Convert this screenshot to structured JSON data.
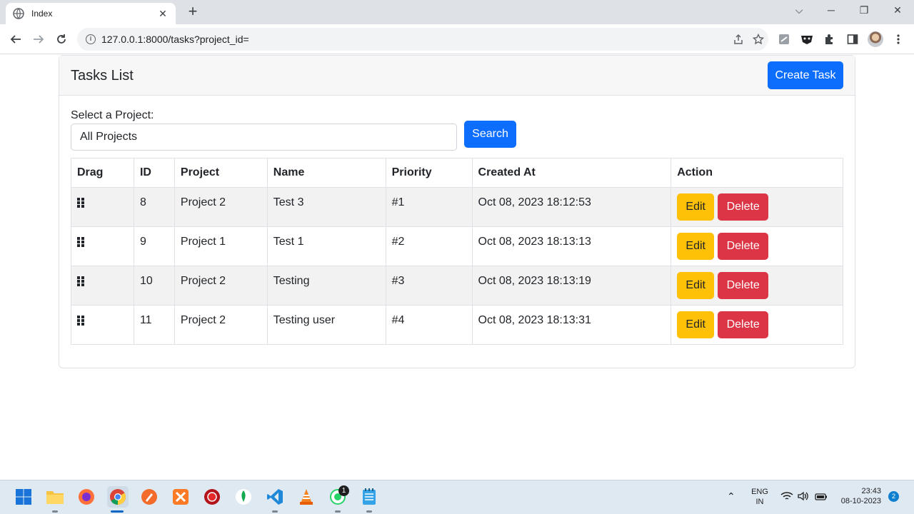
{
  "browser": {
    "tab_title": "Index",
    "new_tab_symbol": "+",
    "url": "127.0.0.1:8000/tasks?project_id="
  },
  "page": {
    "card_title": "Tasks List",
    "create_button": "Create Task",
    "select_label": "Select a Project:",
    "select_value": "All Projects",
    "search_button": "Search",
    "columns": [
      "Drag",
      "ID",
      "Project",
      "Name",
      "Priority",
      "Created At",
      "Action"
    ],
    "rows": [
      {
        "id": "8",
        "project": "Project 2",
        "name": "Test 3",
        "priority": "#1",
        "created_at": "Oct 08, 2023 18:12:53"
      },
      {
        "id": "9",
        "project": "Project 1",
        "name": "Test 1",
        "priority": "#2",
        "created_at": "Oct 08, 2023 18:13:13"
      },
      {
        "id": "10",
        "project": "Project 2",
        "name": "Testing",
        "priority": "#3",
        "created_at": "Oct 08, 2023 18:13:19"
      },
      {
        "id": "11",
        "project": "Project 2",
        "name": "Testing user",
        "priority": "#4",
        "created_at": "Oct 08, 2023 18:13:31"
      }
    ],
    "edit_label": "Edit",
    "delete_label": "Delete"
  },
  "taskbar": {
    "whatsapp_badge": "1",
    "lang_line1": "ENG",
    "lang_line2": "IN",
    "time": "23:43",
    "date": "08-10-2023",
    "notification_count": "2"
  },
  "colors": {
    "primary": "#0d6efd",
    "warning": "#ffc107",
    "danger": "#dc3545"
  }
}
